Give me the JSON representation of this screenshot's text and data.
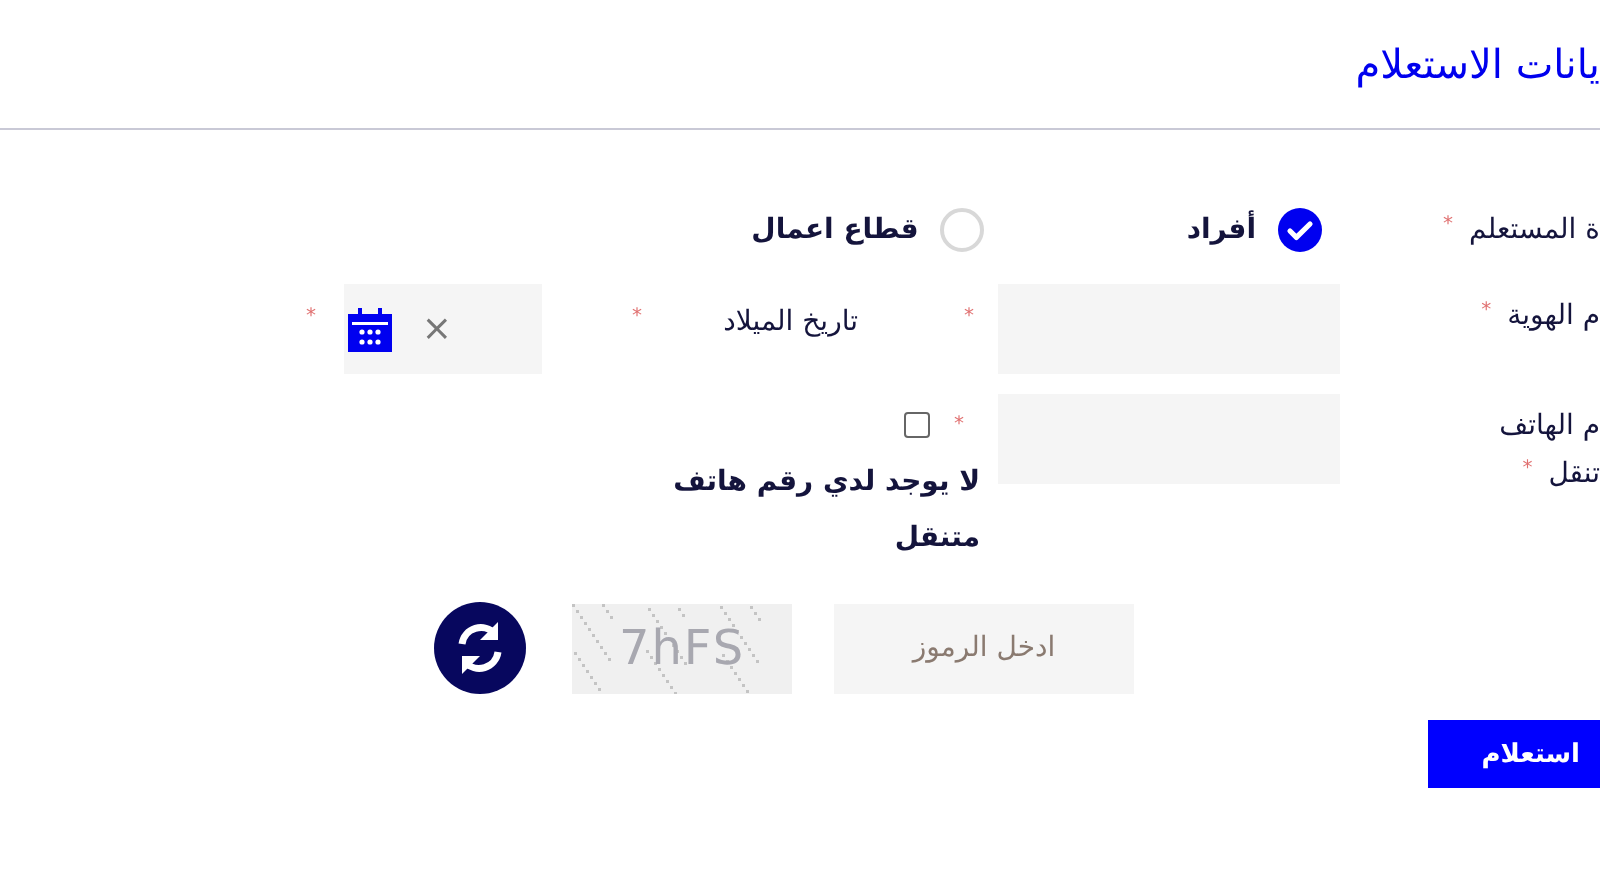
{
  "title": "يانات الاستعلام",
  "requester_type": {
    "label": "ة المستعلم",
    "required_mark": "*",
    "options": [
      {
        "label": "أفراد",
        "selected": true
      },
      {
        "label": "قطاع اعمال",
        "selected": false
      }
    ]
  },
  "id_number": {
    "label": "م الهوية",
    "required_mark": "*",
    "field_mark": "*"
  },
  "birth_date": {
    "label": "تاريخ الميلاد",
    "required_mark": "*",
    "clear": "×",
    "field_mark": "*"
  },
  "mobile": {
    "label_lines": [
      "م الهاتف",
      "تنقل"
    ],
    "required_mark": "*",
    "field_mark": "*"
  },
  "no_mobile": {
    "checked": false,
    "label": "لا يوجد لدي رقم هاتف متنقل"
  },
  "captcha": {
    "placeholder": "ادخل الرموز",
    "code": "7hFS"
  },
  "submit": "استعلام"
}
